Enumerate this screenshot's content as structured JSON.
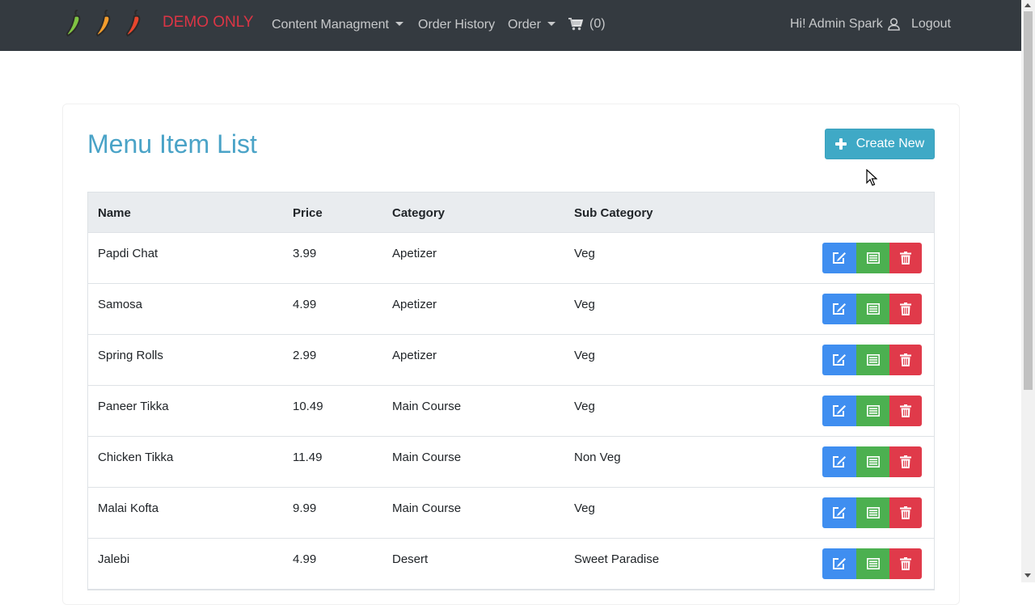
{
  "navbar": {
    "brand": "DEMO ONLY",
    "links": {
      "content_management": "Content Managment",
      "order_history": "Order History",
      "order": "Order"
    },
    "cart_count": "(0)",
    "greeting": "Hi! Admin Spark",
    "logout": "Logout"
  },
  "page": {
    "title": "Menu Item List",
    "create_button": "Create New"
  },
  "table": {
    "headers": {
      "name": "Name",
      "price": "Price",
      "category": "Category",
      "sub_category": "Sub Category"
    },
    "rows": [
      {
        "name": "Papdi Chat",
        "price": "3.99",
        "category": "Apetizer",
        "sub_category": "Veg"
      },
      {
        "name": "Samosa",
        "price": "4.99",
        "category": "Apetizer",
        "sub_category": "Veg"
      },
      {
        "name": "Spring Rolls",
        "price": "2.99",
        "category": "Apetizer",
        "sub_category": "Veg"
      },
      {
        "name": "Paneer Tikka",
        "price": "10.49",
        "category": "Main Course",
        "sub_category": "Veg"
      },
      {
        "name": "Chicken Tikka",
        "price": "11.49",
        "category": "Main Course",
        "sub_category": "Non Veg"
      },
      {
        "name": "Malai Kofta",
        "price": "9.99",
        "category": "Main Course",
        "sub_category": "Veg"
      },
      {
        "name": "Jalebi",
        "price": "4.99",
        "category": "Desert",
        "sub_category": "Sweet Paradise"
      }
    ]
  },
  "colors": {
    "navbar_bg": "#343a40",
    "brand": "#dc3545",
    "title": "#4aa3c7",
    "create_button": "#3fa9c6",
    "edit_button": "#3f8ef0",
    "details_button": "#4cb050",
    "delete_button": "#e03a4a"
  },
  "icons": {
    "logo": "chili-peppers-logo",
    "cart": "shopping-cart-icon",
    "user": "user-icon",
    "create": "plus-icon",
    "edit": "edit-icon",
    "details": "list-icon",
    "delete": "trash-icon"
  }
}
